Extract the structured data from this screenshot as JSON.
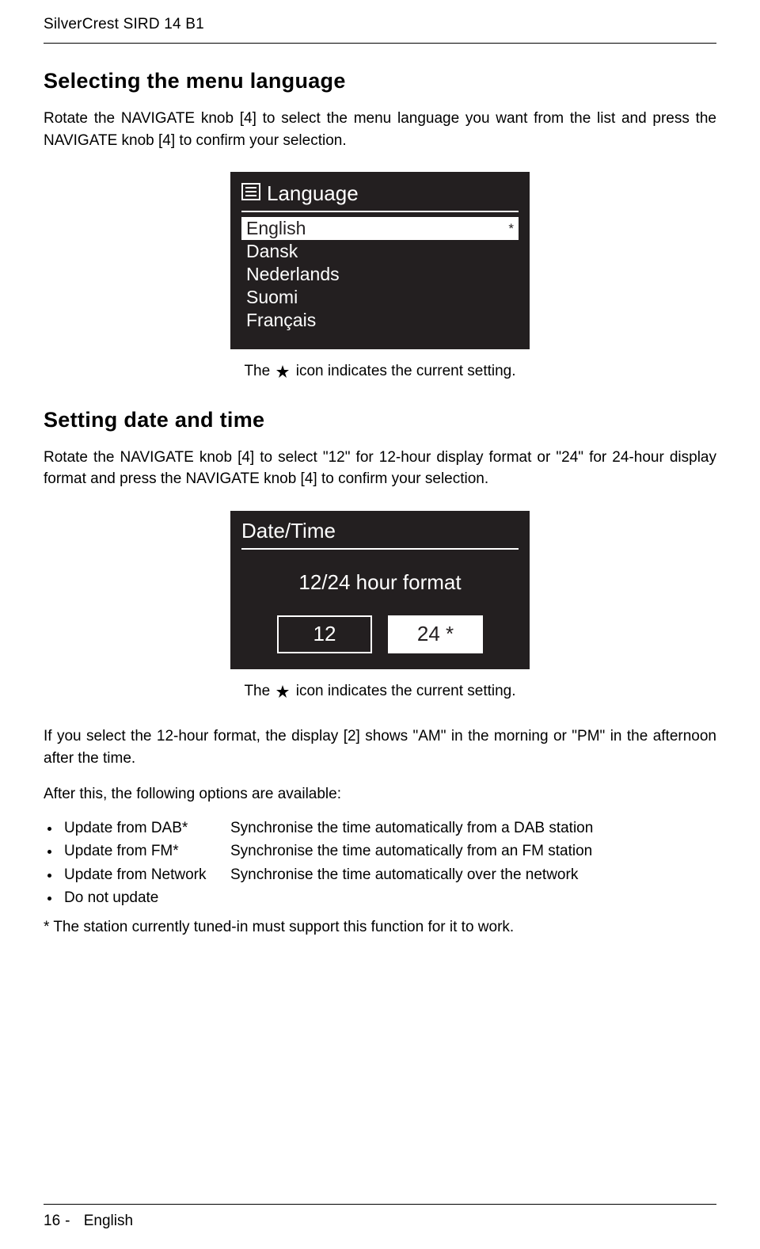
{
  "header": {
    "product": "SilverCrest SIRD 14 B1"
  },
  "section1": {
    "heading": "Selecting the menu language",
    "para": "Rotate the NAVIGATE knob [4] to select the menu language you want from the list and press the NAVIGATE knob [4] to confirm your selection."
  },
  "lang_screen": {
    "title": "Language",
    "items": [
      "English",
      "Dansk",
      "Nederlands",
      "Suomi",
      "Français"
    ],
    "selected_marker": "*"
  },
  "caption1_a": "The",
  "caption1_b": "icon indicates the current setting.",
  "section2": {
    "heading": "Setting date and time",
    "para": "Rotate the NAVIGATE knob [4] to select \"12\" for 12-hour display format or \"24\" for 24-hour display format and press the NAVIGATE knob [4] to confirm your selection."
  },
  "dt_screen": {
    "title": "Date/Time",
    "subtitle": "12/24 hour format",
    "opt1": "12",
    "opt2": "24",
    "sel_marker": "*"
  },
  "caption2_a": "The",
  "caption2_b": "icon indicates the current setting.",
  "para3": "If you select the 12-hour format, the display [2] shows \"AM\" in the morning or \"PM\" in the afternoon after the time.",
  "para4": "After this, the following options are available:",
  "options": [
    {
      "term": "Update from DAB*",
      "desc": "Synchronise the time automatically from a DAB station"
    },
    {
      "term": "Update from FM*",
      "desc": "Synchronise the time automatically from an FM station"
    },
    {
      "term": "Update from Network",
      "desc": "Synchronise the time automatically over the network"
    },
    {
      "term": "Do not update",
      "desc": ""
    }
  ],
  "footnote": "* The station currently tuned-in must support this function for it to work.",
  "footer": {
    "page": "16",
    "sep": "-",
    "lang": "English"
  }
}
